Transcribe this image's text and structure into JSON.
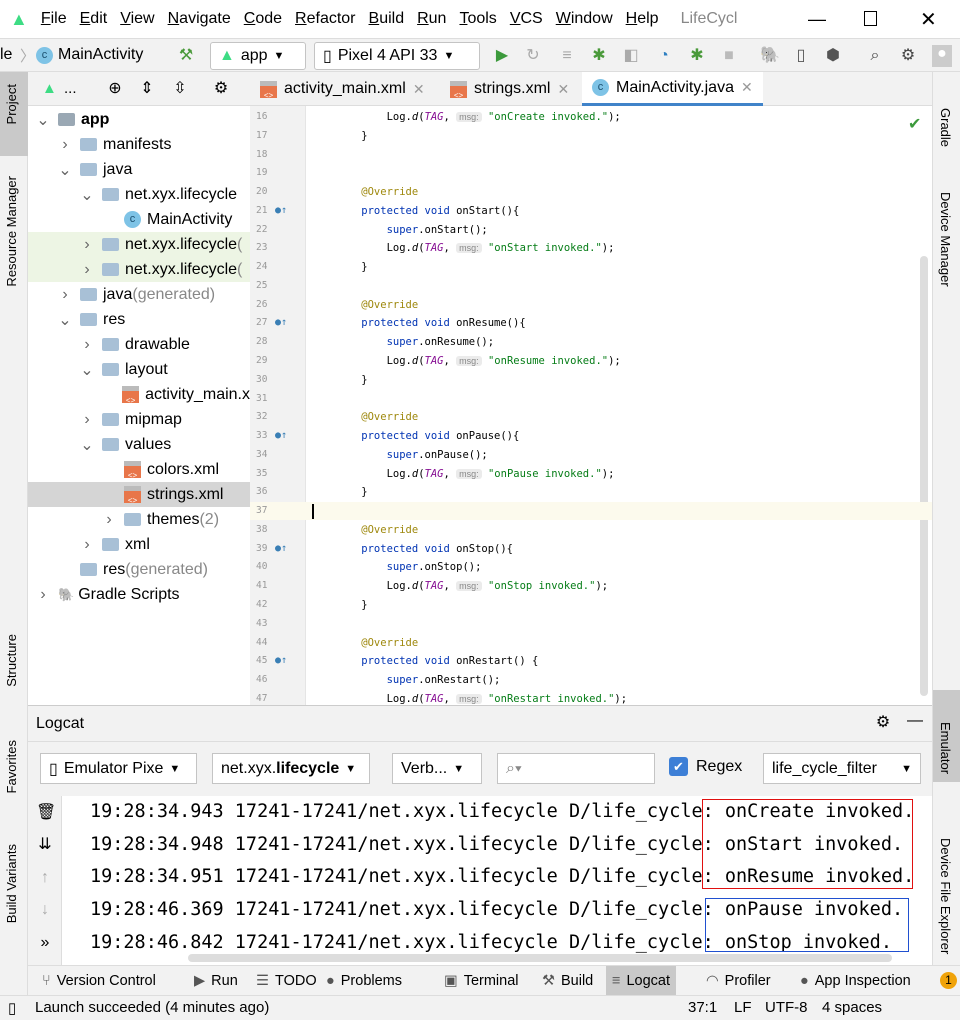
{
  "menu": {
    "items": [
      "File",
      "Edit",
      "View",
      "Navigate",
      "Code",
      "Refactor",
      "Build",
      "Run",
      "Tools",
      "VCS",
      "Window",
      "Help"
    ],
    "window_title": "LifeCycl"
  },
  "navbar": {
    "breadcrumb_prev": "le",
    "breadcrumb_current": "MainActivity",
    "run_config": "app",
    "device": "Pixel 4 API 33"
  },
  "left_strip": {
    "project": "Project",
    "resource_manager": "Resource Manager",
    "structure": "Structure",
    "favorites": "Favorites",
    "build_variants": "Build Variants"
  },
  "right_strip": {
    "gradle": "Gradle",
    "device_manager": "Device Manager",
    "emulator": "Emulator",
    "device_file_explorer": "Device File Explorer"
  },
  "project": {
    "view_selector": "...",
    "tree": [
      {
        "label": "app",
        "depth": 0,
        "arrow": "down",
        "icon": "module",
        "bold": true
      },
      {
        "label": "manifests",
        "depth": 1,
        "arrow": "right",
        "icon": "folder"
      },
      {
        "label": "java",
        "depth": 1,
        "arrow": "down",
        "icon": "folder"
      },
      {
        "label": "net.xyx.lifecycle",
        "depth": 2,
        "arrow": "down",
        "icon": "folder"
      },
      {
        "label": "MainActivity",
        "depth": 3,
        "arrow": "",
        "icon": "class"
      },
      {
        "label": "net.xyx.lifecycle",
        "suffix": " (",
        "depth": 2,
        "arrow": "right",
        "icon": "folder",
        "hl": true
      },
      {
        "label": "net.xyx.lifecycle",
        "suffix": " (",
        "depth": 2,
        "arrow": "right",
        "icon": "folder",
        "hl": true
      },
      {
        "label": "java",
        "suffix": " (generated)",
        "depth": 1,
        "arrow": "right",
        "icon": "folder"
      },
      {
        "label": "res",
        "depth": 1,
        "arrow": "down",
        "icon": "folder"
      },
      {
        "label": "drawable",
        "depth": 2,
        "arrow": "right",
        "icon": "folder"
      },
      {
        "label": "layout",
        "depth": 2,
        "arrow": "down",
        "icon": "folder"
      },
      {
        "label": "activity_main.x",
        "depth": 3,
        "arrow": "",
        "icon": "xml"
      },
      {
        "label": "mipmap",
        "depth": 2,
        "arrow": "right",
        "icon": "folder"
      },
      {
        "label": "values",
        "depth": 2,
        "arrow": "down",
        "icon": "folder"
      },
      {
        "label": "colors.xml",
        "depth": 3,
        "arrow": "",
        "icon": "xml"
      },
      {
        "label": "strings.xml",
        "depth": 3,
        "arrow": "",
        "icon": "xml",
        "sel": true
      },
      {
        "label": "themes",
        "suffix": " (2)",
        "depth": 3,
        "arrow": "right",
        "icon": "folder"
      },
      {
        "label": "xml",
        "depth": 2,
        "arrow": "right",
        "icon": "folder"
      },
      {
        "label": "res",
        "suffix": " (generated)",
        "depth": 1,
        "arrow": "",
        "icon": "folder"
      },
      {
        "label": "Gradle Scripts",
        "depth": 0,
        "arrow": "right",
        "icon": "gradle"
      }
    ]
  },
  "tabs": [
    {
      "label": "activity_main.xml",
      "icon": "xml"
    },
    {
      "label": "strings.xml",
      "icon": "xml"
    },
    {
      "label": "MainActivity.java",
      "icon": "class",
      "active": true
    }
  ],
  "editor": {
    "current_line": 37,
    "lines": [
      {
        "n": 16,
        "s": [
          [
            "",
            "        Log."
          ],
          [
            "itd",
            "d"
          ],
          [
            "",
            "("
          ],
          [
            "it",
            "TAG"
          ],
          [
            "",
            ", "
          ],
          [
            "hint",
            "msg:"
          ],
          [
            "",
            " "
          ],
          [
            "str",
            "\"onCreate invoked.\""
          ],
          [
            "",
            ");"
          ]
        ]
      },
      {
        "n": 17,
        "s": [
          [
            "",
            "    }"
          ]
        ]
      },
      {
        "n": 18,
        "s": []
      },
      {
        "n": 19,
        "s": []
      },
      {
        "n": 20,
        "s": [
          [
            "ann",
            "    @Override"
          ]
        ]
      },
      {
        "n": 21,
        "m": true,
        "s": [
          [
            "kw",
            "    protected void "
          ],
          [
            "",
            "onStart(){"
          ]
        ]
      },
      {
        "n": 22,
        "s": [
          [
            "kw",
            "        super"
          ],
          [
            "",
            ".onStart();"
          ]
        ]
      },
      {
        "n": 23,
        "s": [
          [
            "",
            "        Log."
          ],
          [
            "itd",
            "d"
          ],
          [
            "",
            "("
          ],
          [
            "it",
            "TAG"
          ],
          [
            "",
            ", "
          ],
          [
            "hint",
            "msg:"
          ],
          [
            "",
            " "
          ],
          [
            "str",
            "\"onStart invoked.\""
          ],
          [
            "",
            ");"
          ]
        ]
      },
      {
        "n": 24,
        "s": [
          [
            "",
            "    }"
          ]
        ]
      },
      {
        "n": 25,
        "s": []
      },
      {
        "n": 26,
        "s": [
          [
            "ann",
            "    @Override"
          ]
        ]
      },
      {
        "n": 27,
        "m": true,
        "s": [
          [
            "kw",
            "    protected void "
          ],
          [
            "",
            "onResume(){"
          ]
        ]
      },
      {
        "n": 28,
        "s": [
          [
            "kw",
            "        super"
          ],
          [
            "",
            ".onResume();"
          ]
        ]
      },
      {
        "n": 29,
        "s": [
          [
            "",
            "        Log."
          ],
          [
            "itd",
            "d"
          ],
          [
            "",
            "("
          ],
          [
            "it",
            "TAG"
          ],
          [
            "",
            ", "
          ],
          [
            "hint",
            "msg:"
          ],
          [
            "",
            " "
          ],
          [
            "str",
            "\"onResume invoked.\""
          ],
          [
            "",
            ");"
          ]
        ]
      },
      {
        "n": 30,
        "s": [
          [
            "",
            "    }"
          ]
        ]
      },
      {
        "n": 31,
        "s": []
      },
      {
        "n": 32,
        "s": [
          [
            "ann",
            "    @Override"
          ]
        ]
      },
      {
        "n": 33,
        "m": true,
        "s": [
          [
            "kw",
            "    protected void "
          ],
          [
            "",
            "onPause(){"
          ]
        ]
      },
      {
        "n": 34,
        "s": [
          [
            "kw",
            "        super"
          ],
          [
            "",
            ".onPause();"
          ]
        ]
      },
      {
        "n": 35,
        "s": [
          [
            "",
            "        Log."
          ],
          [
            "itd",
            "d"
          ],
          [
            "",
            "("
          ],
          [
            "it",
            "TAG"
          ],
          [
            "",
            ", "
          ],
          [
            "hint",
            "msg:"
          ],
          [
            "",
            " "
          ],
          [
            "str",
            "\"onPause invoked.\""
          ],
          [
            "",
            ");"
          ]
        ]
      },
      {
        "n": 36,
        "s": [
          [
            "",
            "    }"
          ]
        ]
      },
      {
        "n": 37,
        "s": []
      },
      {
        "n": 38,
        "s": [
          [
            "ann",
            "    @Override"
          ]
        ]
      },
      {
        "n": 39,
        "m": true,
        "s": [
          [
            "kw",
            "    protected void "
          ],
          [
            "",
            "onStop(){"
          ]
        ]
      },
      {
        "n": 40,
        "s": [
          [
            "kw",
            "        super"
          ],
          [
            "",
            ".onStop();"
          ]
        ]
      },
      {
        "n": 41,
        "s": [
          [
            "",
            "        Log."
          ],
          [
            "itd",
            "d"
          ],
          [
            "",
            "("
          ],
          [
            "it",
            "TAG"
          ],
          [
            "",
            ", "
          ],
          [
            "hint",
            "msg:"
          ],
          [
            "",
            " "
          ],
          [
            "str",
            "\"onStop invoked.\""
          ],
          [
            "",
            ");"
          ]
        ]
      },
      {
        "n": 42,
        "s": [
          [
            "",
            "    }"
          ]
        ]
      },
      {
        "n": 43,
        "s": []
      },
      {
        "n": 44,
        "s": [
          [
            "ann",
            "    @Override"
          ]
        ]
      },
      {
        "n": 45,
        "m": true,
        "s": [
          [
            "kw",
            "    protected void "
          ],
          [
            "",
            "onRestart() {"
          ]
        ]
      },
      {
        "n": 46,
        "s": [
          [
            "kw",
            "        super"
          ],
          [
            "",
            ".onRestart();"
          ]
        ]
      },
      {
        "n": 47,
        "s": [
          [
            "",
            "        Log."
          ],
          [
            "itd",
            "d"
          ],
          [
            "",
            "("
          ],
          [
            "it",
            "TAG"
          ],
          [
            "",
            ", "
          ],
          [
            "hint",
            "msg:"
          ],
          [
            "",
            " "
          ],
          [
            "str",
            "\"onRestart invoked.\""
          ],
          [
            "",
            ");"
          ]
        ]
      }
    ]
  },
  "logcat": {
    "title": "Logcat",
    "device": "Emulator Pixe",
    "package_prefix": "net.xyx.",
    "package_bold": "lifecycle",
    "level": "Verb...",
    "search_placeholder": "",
    "regex_label": "Regex",
    "regex_checked": true,
    "filter": "life_cycle_filter",
    "rows": [
      {
        "time": "19:28:34.943",
        "pid": "17241-17241/net.xyx.lifecycle",
        "tag": "D/life_cycle:",
        "msg": "onCreate invoked.",
        "box": "red"
      },
      {
        "time": "19:28:34.948",
        "pid": "17241-17241/net.xyx.lifecycle",
        "tag": "D/life_cycle:",
        "msg": "onStart invoked.",
        "box": "red"
      },
      {
        "time": "19:28:34.951",
        "pid": "17241-17241/net.xyx.lifecycle",
        "tag": "D/life_cycle:",
        "msg": "onResume invoked.",
        "box": "red"
      },
      {
        "time": "19:28:46.369",
        "pid": "17241-17241/net.xyx.lifecycle",
        "tag": "D/life_cycle:",
        "msg": "onPause invoked.",
        "box": "blue"
      },
      {
        "time": "19:28:46.842",
        "pid": "17241-17241/net.xyx.lifecycle",
        "tag": "D/life_cycle:",
        "msg": "onStop invoked.",
        "box": "blue"
      }
    ]
  },
  "toolwindows": [
    {
      "label": "Version Control",
      "icon": "⑂"
    },
    {
      "label": "Run",
      "icon": "▶"
    },
    {
      "label": "TODO",
      "icon": "☰"
    },
    {
      "label": "Problems",
      "icon": "●"
    },
    {
      "label": "Terminal",
      "icon": "▣"
    },
    {
      "label": "Build",
      "icon": "⚒"
    },
    {
      "label": "Logcat",
      "icon": "≡",
      "sel": true
    },
    {
      "label": "Profiler",
      "icon": "◠"
    },
    {
      "label": "App Inspection",
      "icon": "●"
    }
  ],
  "notification_count": "1",
  "status": {
    "message": "Launch succeeded (4 minutes ago)",
    "position": "37:1",
    "line_ending": "LF",
    "encoding": "UTF-8",
    "indent": "4 spaces"
  },
  "colors": {
    "accent": "#4083c9",
    "android_green": "#3ddc84",
    "red_box": "#e01010",
    "blue_box": "#2050d0"
  }
}
